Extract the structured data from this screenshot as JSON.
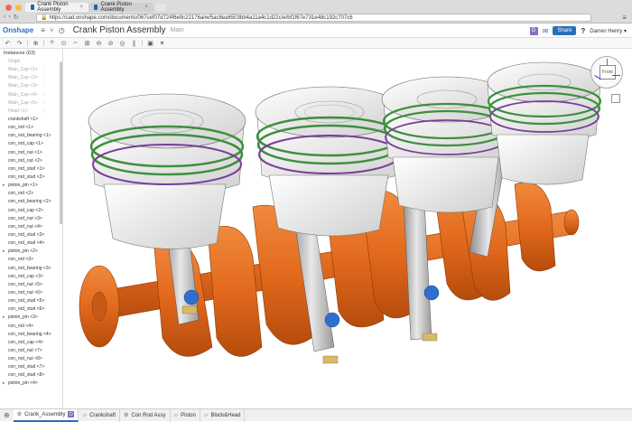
{
  "browser": {
    "tabs": [
      {
        "label": "Crank Piston Assembly",
        "close": "×"
      },
      {
        "label": "Crank Piston Assembly",
        "close": "×"
      }
    ],
    "url": "https://cad.onshape.com/documents/067cef07d724f6e9c22176a/w/5ac8ea6503bb4a11a4c1d22c/e/bf1f67e731e48c192c707c6"
  },
  "app": {
    "logo": "Onshape",
    "title": "Crank Piston Assembly",
    "workspace": "Main",
    "badge": "D",
    "share_label": "Share",
    "user": "Darren Henry",
    "user_caret": "▾",
    "help": "?"
  },
  "sidebar": {
    "header": "Instances (63)",
    "items": [
      {
        "label": "Origin",
        "dim": true
      },
      {
        "label": "Main_Cap <1>",
        "dim": true
      },
      {
        "label": "Main_Cap <2>",
        "dim": true
      },
      {
        "label": "Main_Cap <3>",
        "dim": true
      },
      {
        "label": "Main_Cap <4>",
        "dim": true
      },
      {
        "label": "Main_Cap <5>",
        "dim": true
      },
      {
        "label": "Head <1>",
        "dim": true
      },
      {
        "label": "crankshaft <1>",
        "dim": false
      },
      {
        "label": "con_rod <1>",
        "dim": false
      },
      {
        "label": "con_rod_bearing <1>",
        "dim": false
      },
      {
        "label": "con_rod_cap <1>",
        "dim": false
      },
      {
        "label": "con_rod_nut <1>",
        "dim": false
      },
      {
        "label": "con_rod_nut <2>",
        "dim": false
      },
      {
        "label": "con_rod_stud <1>",
        "dim": false
      },
      {
        "label": "con_rod_stud <2>",
        "dim": false
      },
      {
        "label": "piston_pin <1>",
        "dim": false,
        "caret": true
      },
      {
        "label": "con_rod <2>",
        "dim": false
      },
      {
        "label": "con_rod_bearing <2>",
        "dim": false
      },
      {
        "label": "con_rod_cap <2>",
        "dim": false
      },
      {
        "label": "con_rod_nut <3>",
        "dim": false
      },
      {
        "label": "con_rod_nut <4>",
        "dim": false
      },
      {
        "label": "con_rod_stud <3>",
        "dim": false
      },
      {
        "label": "con_rod_stud <4>",
        "dim": false
      },
      {
        "label": "piston_pin <2>",
        "dim": false,
        "caret": true
      },
      {
        "label": "con_rod <3>",
        "dim": false
      },
      {
        "label": "con_rod_bearing <3>",
        "dim": false
      },
      {
        "label": "con_rod_cap <3>",
        "dim": false
      },
      {
        "label": "con_rod_nut <5>",
        "dim": false
      },
      {
        "label": "con_rod_nut <6>",
        "dim": false
      },
      {
        "label": "con_rod_stud <5>",
        "dim": false
      },
      {
        "label": "con_rod_stud <6>",
        "dim": false
      },
      {
        "label": "piston_pin <3>",
        "dim": false,
        "caret": true
      },
      {
        "label": "con_rod <4>",
        "dim": false
      },
      {
        "label": "con_rod_bearing <4>",
        "dim": false
      },
      {
        "label": "con_rod_cap <4>",
        "dim": false
      },
      {
        "label": "con_rod_nut <7>",
        "dim": false
      },
      {
        "label": "con_rod_nut <8>",
        "dim": false
      },
      {
        "label": "con_rod_stud <7>",
        "dim": false
      },
      {
        "label": "con_rod_stud <8>",
        "dim": false
      },
      {
        "label": "piston_pin <4>",
        "dim": false,
        "caret": true
      }
    ]
  },
  "viewcube": {
    "face": "Front"
  },
  "bottom_tabs": [
    {
      "label": "Crank_Assembly",
      "active": true,
      "badge": "D"
    },
    {
      "label": "Crankshaft",
      "active": false
    },
    {
      "label": "Con Rod Assy",
      "active": false
    },
    {
      "label": "Piston",
      "active": false
    },
    {
      "label": "Block&Head",
      "active": false
    }
  ],
  "colors": {
    "accent": "#2a70b8",
    "crank": "#e2691c",
    "piston": "#f2f2f2",
    "ring_green": "#3f8f3f",
    "ring_purple": "#7a3e9a",
    "bearing_blue": "#2f6fd0"
  }
}
